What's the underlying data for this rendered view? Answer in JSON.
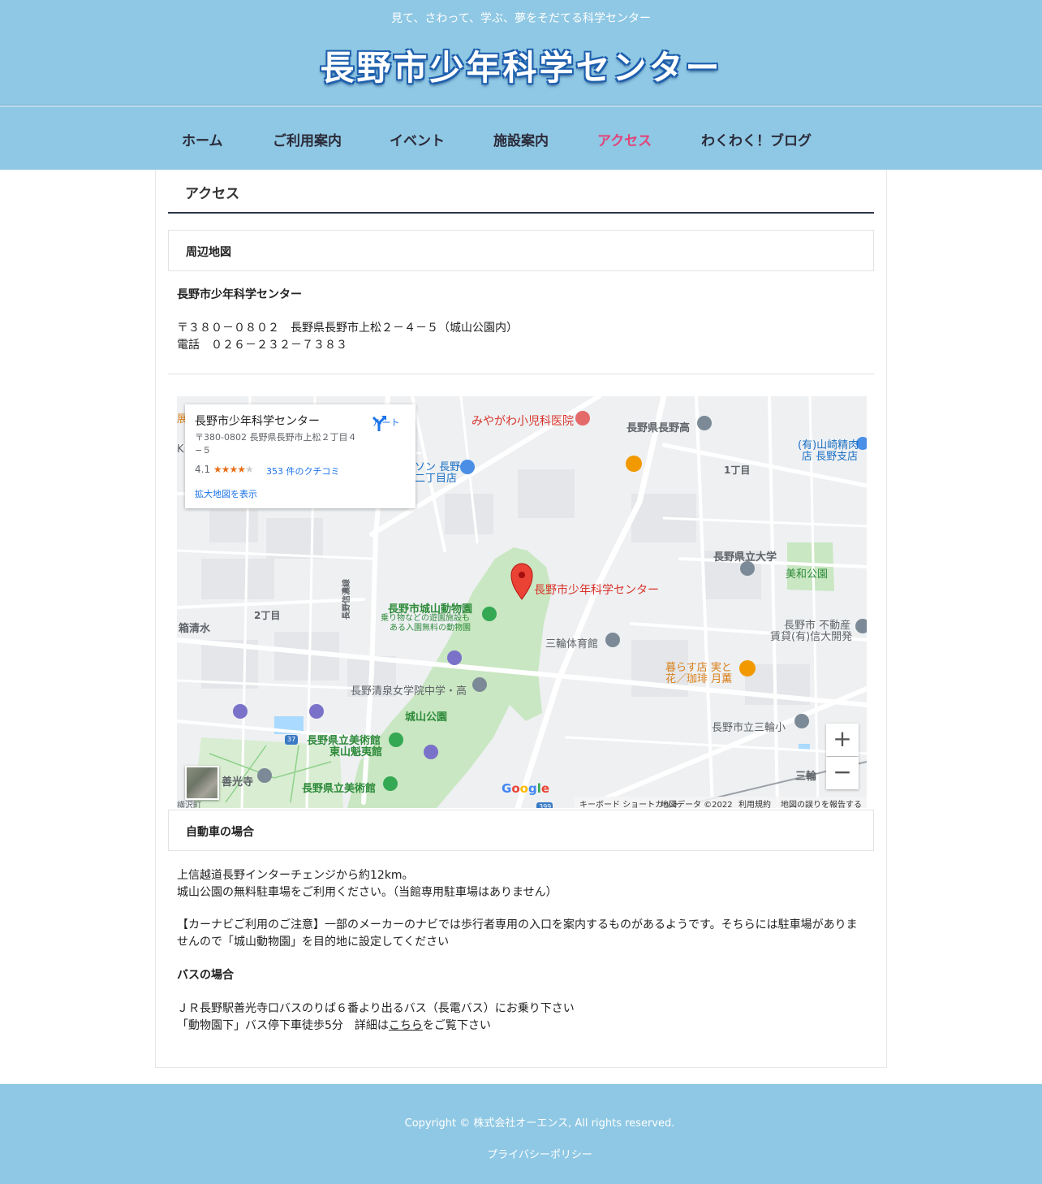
{
  "header": {
    "tagline": "見て、さわって、学ぶ、夢をそだてる科学センター",
    "site_title": "長野市少年科学センター"
  },
  "nav": {
    "items": [
      {
        "label": "ホーム"
      },
      {
        "label": "ご利用案内"
      },
      {
        "label": "イベント"
      },
      {
        "label": "施設案内"
      },
      {
        "label": "アクセス",
        "active": true
      },
      {
        "label": "わくわく！ブログ"
      }
    ]
  },
  "main": {
    "page_title": "アクセス",
    "map_section": {
      "heading": "周辺地図",
      "facility_name": "長野市少年科学センター",
      "address": "〒３８０－０８０２　長野県長野市上松２－４－５（城山公園内）",
      "phone": "電話　０２６－２３２－７３８３"
    },
    "map": {
      "info_card": {
        "name": "長野市少年科学センター",
        "address": "〒380-0802 長野県長野市上松２丁目４−５",
        "rating": "4.1",
        "stars": "★★★★",
        "star_off": "★",
        "reviews": "353 件のクチコミ",
        "enlarge": "拡大地図を表示",
        "route": "ルート"
      },
      "labels": {
        "pin": "長野市少年科学センター",
        "clinic": "みやがわ小児科医院",
        "nagano_high": "長野県長野高",
        "chome1": "1丁目",
        "yamazaki": "(有)山崎精肉",
        "yamazaki2": "店 長野支店",
        "shop": "ソン 長野",
        "shop2": "二丁目店",
        "univ": "長野県立大学",
        "miwa_park": "美和公園",
        "zoo": "長野市城山動物園",
        "zoo_sub1": "乗り物などの遊園施設も",
        "zoo_sub2": "ある入園無料の動物園",
        "chome2": "2丁目",
        "hakoshimizu": "箱清水",
        "shinano_road": "長野信濃線",
        "gym": "三輪体育館",
        "realestate": "長野市 不動産",
        "realestate2": "賃貸(有)信大開発",
        "cafe": "暮らす店 実と",
        "cafe2": "花／珈琲 月薫",
        "seisen": "長野清泉女学院中学・高",
        "joyama_park": "城山公園",
        "miwa_elem": "長野市立三輪小",
        "museum": "長野県立美術館",
        "museum2": "東山魁夷館",
        "zenkoji": "善光寺",
        "museum_b": "長野県立美術館",
        "miwa": "三輪",
        "route37": "37",
        "route399": "399",
        "edge_left": "展",
        "edge_k": "K",
        "edge_bottom": "横沢町"
      },
      "google": [
        "G",
        "o",
        "o",
        "g",
        "l",
        "e"
      ],
      "zoom_in": "+",
      "zoom_out": "−",
      "attribution": {
        "shortcuts": "キーボード ショートカット",
        "data": "地図データ ©2022",
        "terms": "利用規約",
        "report": "地図の誤りを報告する"
      }
    },
    "car_section": {
      "heading": "自動車の場合",
      "line1": "上信越道長野インターチェンジから約12km。",
      "line2": "城山公園の無料駐車場をご利用ください。（当館専用駐車場はありません）",
      "note": "【カーナビご利用のご注意】一部のメーカーのナビでは歩行者専用の入口を案内するものがあるようです。そちらには駐車場がありま",
      "note2": "せんので「城山動物園」を目的地に設定してください"
    },
    "bus_section": {
      "heading": "バスの場合",
      "line1": "ＪＲ長野駅善光寺口バスのりば６番より出るバス（長電バス）にお乗り下さい",
      "line2_prefix": "「動物園下」バス停下車徒歩5分　詳細は",
      "line2_link": "こちら",
      "line2_suffix": "をご覧下さい"
    }
  },
  "footer": {
    "copyright": "Copyright © 株式会社オーエンス, All rights reserved.",
    "privacy": "プライバシーポリシー"
  },
  "colors": {
    "header_bg": "#8fc8e4",
    "nav_active": "#e0457a",
    "title_rule": "#2c3548",
    "map_pin": "#ea4335"
  }
}
